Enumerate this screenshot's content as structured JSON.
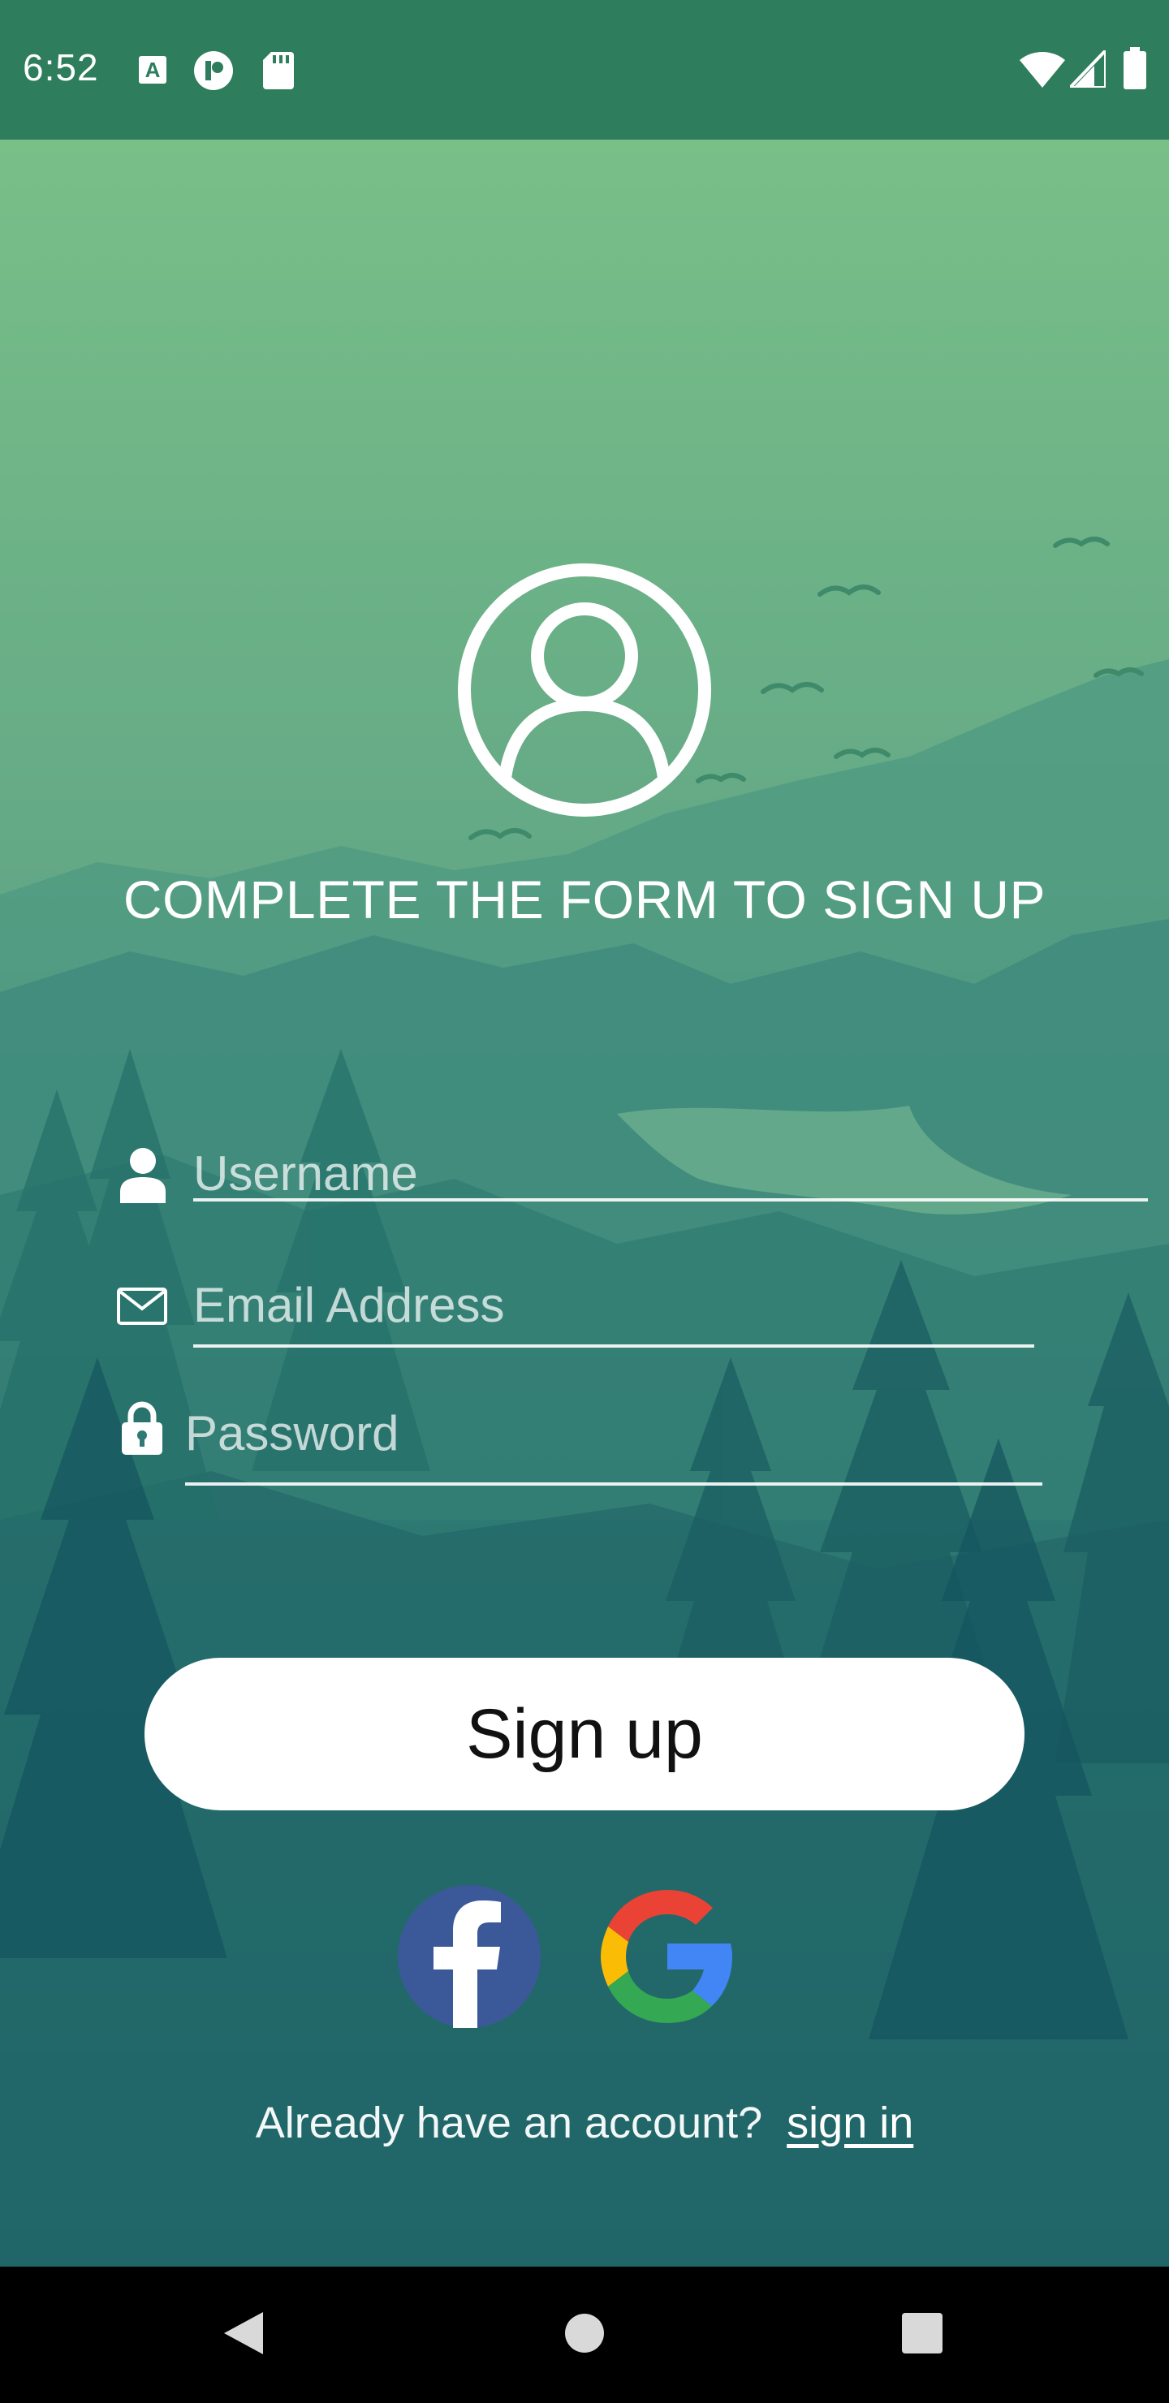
{
  "status_bar": {
    "time": "6:52",
    "left_icons": [
      "keyboard-a-icon",
      "app-badge-icon",
      "sd-card-icon"
    ],
    "right_icons": [
      "wifi-icon",
      "signal-icon",
      "battery-icon"
    ]
  },
  "form": {
    "title": "COMPLETE THE FORM TO SIGN UP",
    "username": {
      "placeholder": "Username",
      "value": "",
      "icon": "person-icon"
    },
    "email": {
      "placeholder": "Email Address",
      "value": "",
      "icon": "envelope-icon"
    },
    "password": {
      "placeholder": "Password",
      "value": "",
      "icon": "lock-icon"
    },
    "signup_label": "Sign up"
  },
  "social": {
    "facebook": "facebook-icon",
    "google": "google-icon"
  },
  "footer": {
    "prompt": "Already have an account?",
    "signin_label": "sign in"
  },
  "nav": {
    "icons": [
      "back-icon",
      "home-icon",
      "recents-icon"
    ]
  },
  "colors": {
    "status_bar": "#2e7d5c",
    "sky_top": "#78bf88",
    "scene_bottom": "#0a4a5e",
    "button_bg": "#ffffff",
    "facebook_blue": "#3b5998"
  }
}
